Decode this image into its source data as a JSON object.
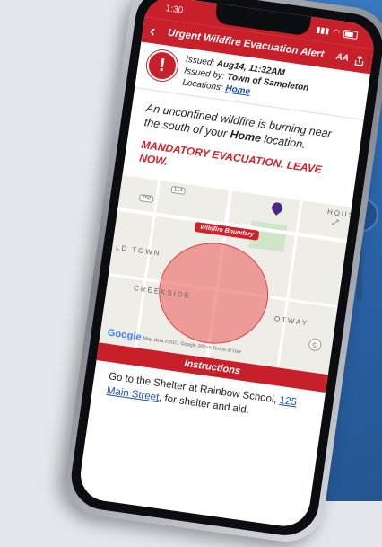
{
  "status": {
    "time": "1:30"
  },
  "nav": {
    "title": "Urgent Wildfire Evacuation Alert",
    "text_size": "AA"
  },
  "meta": {
    "issued_label": "Issued:",
    "issued_value": "Aug14, 11:32AM",
    "issuer_label": "Issued by:",
    "issuer_value": "Town of Sampleton",
    "locations_label": "Locations:",
    "locations_value": "Home"
  },
  "message": {
    "part1": "An unconfined wildfire is burning near the south of your ",
    "bold": "Home",
    "part2": " location.",
    "mandatory": "MANDATORY EVACUATION. LEAVE NOW."
  },
  "map": {
    "boundary_label": "Wildfire Boundary",
    "lbl_ldtown": "LD TOWN",
    "lbl_creekside": "CREEKSIDE",
    "lbl_otway": "OTWAY",
    "lbl_house": "HOUS",
    "hwy1": "114",
    "hwy2": "750",
    "google": "Google",
    "attribution": "Map data ©2021 Google   200 m        Terms of Use"
  },
  "instructions": {
    "title": "Instructions",
    "text1": "Go to the Shelter at Rainbow School, ",
    "link": "125 Main Street",
    "text2": ", for shelter and aid."
  }
}
